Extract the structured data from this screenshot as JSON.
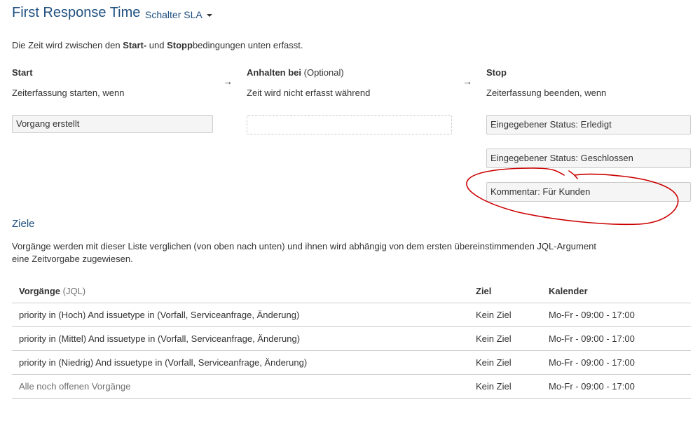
{
  "header": {
    "title": "First Response Time",
    "sla_selector": "Schalter SLA",
    "caret_icon": "caret-down-icon"
  },
  "intro": {
    "prefix": "Die Zeit wird zwischen den ",
    "start_word": "Start-",
    "middle": " und ",
    "stop_word": "Stopp",
    "suffix": "bedingungen unten erfasst."
  },
  "conditions": {
    "arrow_icon": "arrow-right-icon",
    "arrow_glyph": "→",
    "start": {
      "heading": "Start",
      "subheading": "Zeiterfassung starten, wenn",
      "items": [
        "Vorgang erstellt"
      ]
    },
    "pause": {
      "heading": "Anhalten bei",
      "heading_optional": "(Optional)",
      "subheading": "Zeit wird nicht erfasst während",
      "items": []
    },
    "stop": {
      "heading": "Stop",
      "subheading": "Zeiterfassung beenden, wenn",
      "items": [
        "Eingegebener Status: Erledigt",
        "Eingegebener Status: Geschlossen",
        "Kommentar: Für Kunden"
      ]
    }
  },
  "annotation": {
    "color": "#cc0000"
  },
  "goals": {
    "title": "Ziele",
    "description": "Vorgänge werden mit dieser Liste verglichen (von oben nach unten) und ihnen wird abhängig von dem ersten übereinstimmenden JQL-Argument eine Zeitvorgabe zugewiesen.",
    "columns": {
      "issues": "Vorgänge",
      "issues_suffix": "(JQL)",
      "goal": "Ziel",
      "calendar": "Kalender"
    },
    "rows": [
      {
        "jql": "priority in (Hoch) And issuetype in (Vorfall, Serviceanfrage, Änderung)",
        "goal": "Kein Ziel",
        "calendar": "Mo-Fr - 09:00 - 17:00"
      },
      {
        "jql": "priority in (Mittel) And issuetype in (Vorfall, Serviceanfrage, Änderung)",
        "goal": "Kein Ziel",
        "calendar": "Mo-Fr - 09:00 - 17:00"
      },
      {
        "jql": "priority in (Niedrig) And issuetype in (Vorfall, Serviceanfrage, Änderung)",
        "goal": "Kein Ziel",
        "calendar": "Mo-Fr - 09:00 - 17:00"
      },
      {
        "jql": "Alle noch offenen Vorgänge",
        "goal": "Kein Ziel",
        "calendar": "Mo-Fr - 09:00 - 17:00"
      }
    ]
  }
}
